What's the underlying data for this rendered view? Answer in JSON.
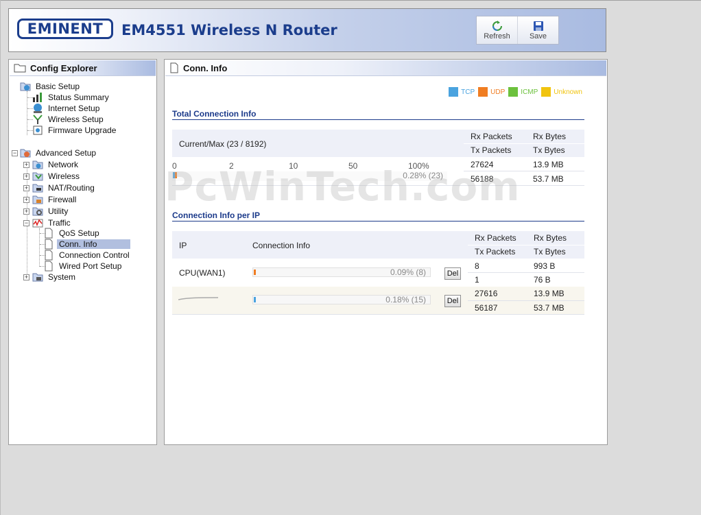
{
  "header": {
    "logo_text": "EMINENT",
    "product_title": "EM4551 Wireless N Router",
    "toolbar": [
      {
        "label": "Refresh",
        "icon": "refresh-icon"
      },
      {
        "label": "Save",
        "icon": "save-icon"
      }
    ]
  },
  "sidebar": {
    "title": "Config Explorer",
    "basic_setup": {
      "label": "Basic Setup",
      "items": [
        "Status Summary",
        "Internet Setup",
        "Wireless Setup",
        "Firmware Upgrade"
      ]
    },
    "advanced_setup": {
      "label": "Advanced Setup",
      "items": [
        "Network",
        "Wireless",
        "NAT/Routing",
        "Firewall",
        "Utility",
        "Traffic"
      ],
      "traffic_items": [
        "QoS Setup",
        "Conn. Info",
        "Connection Control",
        "Wired Port Setup"
      ],
      "last": "System"
    },
    "selected": "Conn. Info"
  },
  "main": {
    "title": "Conn. Info",
    "legend": [
      {
        "label": "TCP",
        "color": "#4aa3df"
      },
      {
        "label": "UDP",
        "color": "#f07d22"
      },
      {
        "label": "ICMP",
        "color": "#6cc13d"
      },
      {
        "label": "Unknown",
        "color": "#f1c40f"
      }
    ],
    "total": {
      "section_title": "Total Connection Info",
      "current_max": "Current/Max (23 / 8192)",
      "headers": {
        "rx_packets": "Rx Packets",
        "rx_bytes": "Rx Bytes",
        "tx_packets": "Tx Packets",
        "tx_bytes": "Tx Bytes"
      },
      "scale": [
        "0",
        "2",
        "10",
        "50",
        "100%"
      ],
      "usage_text": "0.28% (23)",
      "usage_fraction": 0.0028,
      "rx_packets": "27624",
      "rx_bytes": "13.9 MB",
      "tx_packets": "56188",
      "tx_bytes": "53.7 MB"
    },
    "per_ip": {
      "section_title": "Connection Info per IP",
      "col_ip": "IP",
      "col_conn": "Connection Info",
      "headers": {
        "rx_packets": "Rx Packets",
        "rx_bytes": "Rx Bytes",
        "tx_packets": "Tx Packets",
        "tx_bytes": "Tx Bytes"
      },
      "rows": [
        {
          "ip": "CPU(WAN1)",
          "usage_text": "0.09% (8)",
          "usage_fraction": 0.0009,
          "del_label": "Del",
          "rx_packets": "8",
          "rx_bytes": "993 B",
          "tx_packets": "1",
          "tx_bytes": "76 B",
          "bar_color": "#f07d22"
        },
        {
          "ip": "",
          "usage_text": "0.18% (15)",
          "usage_fraction": 0.0018,
          "del_label": "Del",
          "rx_packets": "27616",
          "rx_bytes": "13.9 MB",
          "tx_packets": "56187",
          "tx_bytes": "53.7 MB",
          "bar_color": "#4aa3df"
        }
      ]
    }
  },
  "watermark": "PcWinTech.com"
}
